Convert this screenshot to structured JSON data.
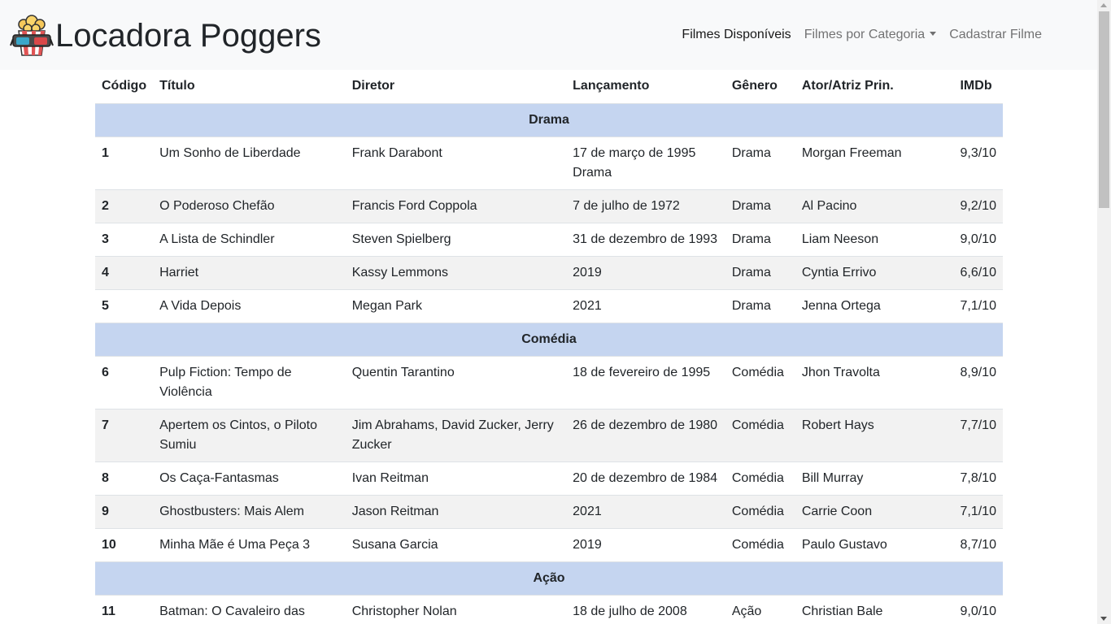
{
  "navbar": {
    "brand": "Locadora Poggers",
    "links": [
      {
        "label": "Filmes Disponíveis"
      },
      {
        "label": "Filmes por Categoria"
      },
      {
        "label": "Cadastrar Filme"
      }
    ]
  },
  "table": {
    "headers": [
      "Código",
      "Título",
      "Diretor",
      "Lançamento",
      "Gênero",
      "Ator/Atriz Prin.",
      "IMDb"
    ],
    "groups": [
      {
        "name": "Drama",
        "rows": [
          {
            "code": "1",
            "title": "Um Sonho de Liberdade",
            "director": "Frank Darabont",
            "release": "17 de março de 1995 Drama",
            "genre": "Drama",
            "actor": "Morgan Freeman",
            "imdb": "9,3/10"
          },
          {
            "code": "2",
            "title": "O Poderoso Chefão",
            "director": "Francis Ford Coppola",
            "release": "7 de julho de 1972",
            "genre": "Drama",
            "actor": "Al Pacino",
            "imdb": "9,2/10"
          },
          {
            "code": "3",
            "title": "A Lista de Schindler",
            "director": "Steven Spielberg",
            "release": "31 de dezembro de 1993",
            "genre": "Drama",
            "actor": "Liam Neeson",
            "imdb": "9,0/10"
          },
          {
            "code": "4",
            "title": "Harriet",
            "director": "Kassy Lemmons",
            "release": "2019",
            "genre": "Drama",
            "actor": "Cyntia Errivo",
            "imdb": "6,6/10"
          },
          {
            "code": "5",
            "title": "A Vida Depois",
            "director": "Megan Park",
            "release": "2021",
            "genre": "Drama",
            "actor": "Jenna Ortega",
            "imdb": "7,1/10"
          }
        ]
      },
      {
        "name": "Comédia",
        "rows": [
          {
            "code": "6",
            "title": "Pulp Fiction: Tempo de Violência",
            "director": "Quentin Tarantino",
            "release": "18 de fevereiro de 1995",
            "genre": "Comédia",
            "actor": "Jhon Travolta",
            "imdb": "8,9/10"
          },
          {
            "code": "7",
            "title": "Apertem os Cintos, o Piloto Sumiu",
            "director": "Jim Abrahams, David Zucker, Jerry Zucker",
            "release": "26 de dezembro de 1980",
            "genre": "Comédia",
            "actor": "Robert Hays",
            "imdb": "7,7/10"
          },
          {
            "code": "8",
            "title": "Os Caça-Fantasmas",
            "director": "Ivan Reitman",
            "release": "20 de dezembro de 1984",
            "genre": "Comédia",
            "actor": "Bill Murray",
            "imdb": "7,8/10"
          },
          {
            "code": "9",
            "title": "Ghostbusters: Mais Alem",
            "director": "Jason Reitman",
            "release": "2021",
            "genre": "Comédia",
            "actor": "Carrie Coon",
            "imdb": "7,1/10"
          },
          {
            "code": "10",
            "title": "Minha Mãe é Uma Peça 3",
            "director": "Susana Garcia",
            "release": "2019",
            "genre": "Comédia",
            "actor": "Paulo Gustavo",
            "imdb": "8,7/10"
          }
        ]
      },
      {
        "name": "Ação",
        "rows": [
          {
            "code": "11",
            "title": "Batman: O Cavaleiro das Trevas",
            "director": "Christopher Nolan",
            "release": "18 de julho de 2008",
            "genre": "Ação",
            "actor": "Christian Bale",
            "imdb": "9,0/10"
          }
        ]
      }
    ]
  },
  "colors": {
    "navbar_bg": "#f8f9fa",
    "group_row_bg": "#c5d5f0",
    "striped_row_bg": "#f2f2f2"
  },
  "icons": {
    "brand_logo": "popcorn-3d-glasses-icon"
  }
}
